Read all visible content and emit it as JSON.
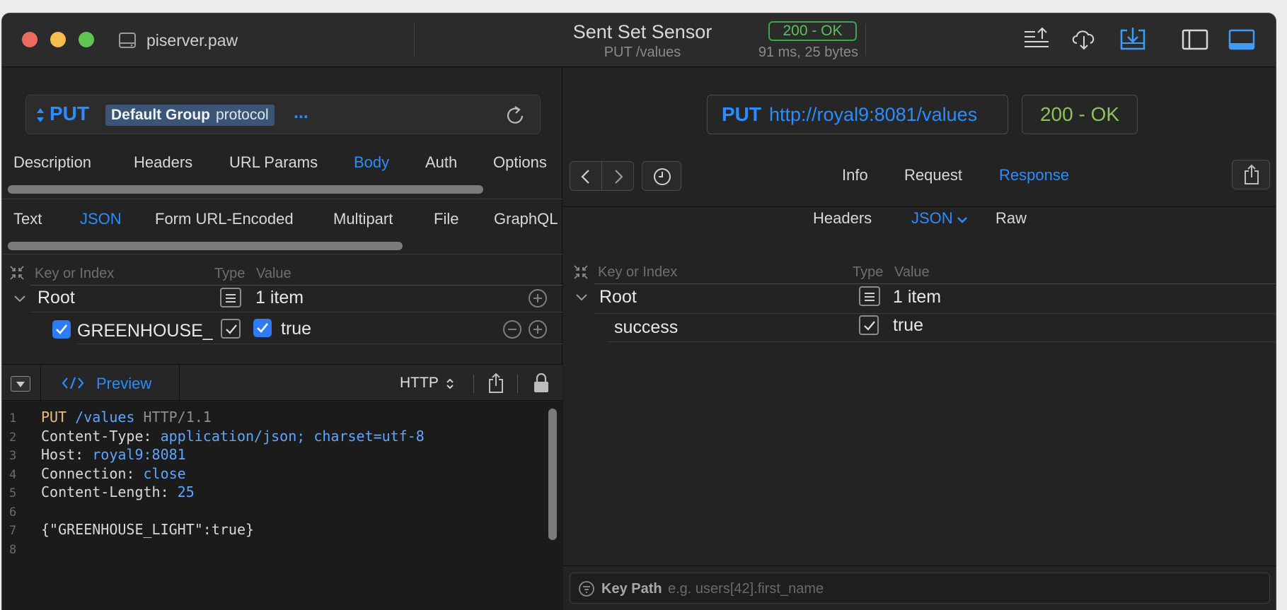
{
  "titlebar": {
    "document_name": "piserver.paw",
    "request_title": "Sent Set Sensor",
    "request_subtitle": "PUT /values",
    "status": "200 - OK",
    "timing": "91 ms, 25 bytes"
  },
  "request": {
    "method": "PUT",
    "url_token_group": "Default Group",
    "url_token_var": "protocol",
    "url_more": "...",
    "tabs": [
      "Description",
      "Headers",
      "URL Params",
      "Body",
      "Auth",
      "Options"
    ],
    "active_tab": "Body",
    "body_types": [
      "Text",
      "JSON",
      "Form URL-Encoded",
      "Multipart",
      "File",
      "GraphQL"
    ],
    "active_body_type": "JSON",
    "columns": {
      "key": "Key or Index",
      "type": "Type",
      "value": "Value"
    },
    "tree": {
      "root_label": "Root",
      "root_value": "1 item",
      "item_key": "GREENHOUSE_",
      "item_value": "true"
    }
  },
  "preview": {
    "label": "Preview",
    "format": "HTTP",
    "lines": [
      {
        "num": "1",
        "parts": [
          {
            "t": "PUT ",
            "c": "kw"
          },
          {
            "t": "/values ",
            "c": "v"
          },
          {
            "t": "HTTP/1.1",
            "c": "g"
          }
        ]
      },
      {
        "num": "2",
        "parts": [
          {
            "t": "Content-Type: ",
            "c": "t"
          },
          {
            "t": "application/json; charset=utf-8",
            "c": "v"
          }
        ]
      },
      {
        "num": "3",
        "parts": [
          {
            "t": "Host: ",
            "c": "t"
          },
          {
            "t": "royal9:8081",
            "c": "v"
          }
        ]
      },
      {
        "num": "4",
        "parts": [
          {
            "t": "Connection: ",
            "c": "t"
          },
          {
            "t": "close",
            "c": "v"
          }
        ]
      },
      {
        "num": "5",
        "parts": [
          {
            "t": "Content-Length: ",
            "c": "t"
          },
          {
            "t": "25",
            "c": "v"
          }
        ]
      },
      {
        "num": "6",
        "parts": []
      },
      {
        "num": "7",
        "parts": [
          {
            "t": "{\"GREENHOUSE_LIGHT\":true}",
            "c": "t"
          }
        ]
      },
      {
        "num": "8",
        "parts": []
      }
    ]
  },
  "response": {
    "method": "PUT",
    "url": "http://royal9:8081/values",
    "status": "200 - OK",
    "tabs": [
      "Info",
      "Request",
      "Response"
    ],
    "active_tab": "Response",
    "subtabs": [
      "Headers",
      "JSON",
      "Raw"
    ],
    "active_subtab": "JSON",
    "columns": {
      "key": "Key or Index",
      "type": "Type",
      "value": "Value"
    },
    "tree": {
      "root_label": "Root",
      "root_value": "1 item",
      "item_key": "success",
      "item_value": "true"
    },
    "keypath_label": "Key Path",
    "keypath_placeholder": "e.g. users[42].first_name"
  },
  "colors": {
    "accent": "#2b8cff",
    "ok_green": "#59c15e",
    "status_green": "#8dc35a"
  }
}
